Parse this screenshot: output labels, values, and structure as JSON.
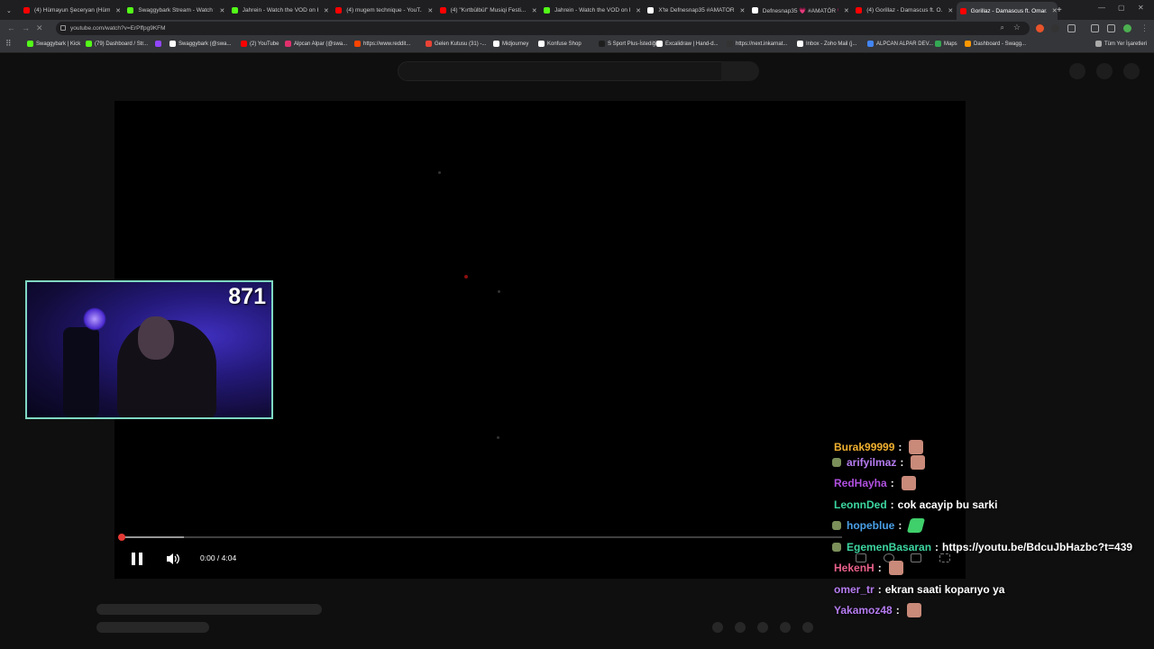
{
  "tabs": [
    {
      "title": "(4) Hümayun Şeceryan (Hümay...",
      "color": "#ff0000",
      "active": false
    },
    {
      "title": "Swaggybark Stream - Watch f...",
      "color": "#53fc18",
      "active": false
    },
    {
      "title": "Jahrein - Watch the VOD on K...",
      "color": "#53fc18",
      "active": false
    },
    {
      "title": "(4) mugem technique - YouT...",
      "color": "#ff0000",
      "active": false
    },
    {
      "title": "(4) \"Kırtbülbül\" Musiqi Festi...",
      "color": "#ff0000",
      "active": false
    },
    {
      "title": "Jahrein - Watch the VOD on K...",
      "color": "#53fc18",
      "active": false
    },
    {
      "title": "X'te Defnesnap35 #AMATÖR...",
      "color": "#ffffff",
      "active": false
    },
    {
      "title": "Defnesnap35 💗 #AMATÖR 💗",
      "color": "#ffffff",
      "active": false
    },
    {
      "title": "(4) Gorillaz - Damascus ft. O...",
      "color": "#ff0000",
      "active": false
    },
    {
      "title": "Gorillaz - Damascus ft. Omar...",
      "color": "#ff0000",
      "active": true
    }
  ],
  "address": {
    "url": "youtube.com/watch?v=ErPffpg9KFM"
  },
  "bookmarks": [
    {
      "label": "Swaggybark | Kick",
      "color": "#53fc18"
    },
    {
      "label": "(79) Dashboard / Str...",
      "color": "#53fc18"
    },
    {
      "label": "",
      "color": "#9146ff"
    },
    {
      "label": "Swaggybark (@swa...",
      "color": "#ffffff"
    },
    {
      "label": "(2) YouTube",
      "color": "#ff0000"
    },
    {
      "label": "Alpcan Alpar (@swa...",
      "color": "#e1306c"
    },
    {
      "label": "https://www.reddit...",
      "color": "#ff4500"
    },
    {
      "label": "Gelen Kutusu (31) -...",
      "color": "#ea4335"
    },
    {
      "label": "Midjourney",
      "color": "#ffffff"
    },
    {
      "label": "Konfuse Shop",
      "color": "#ffffff"
    },
    {
      "label": "S Sport Plus-İstediği...",
      "color": "#1e1e1e"
    },
    {
      "label": "Excalidraw | Hand-d...",
      "color": "#ffffff"
    },
    {
      "label": "https://next.inkarnat...",
      "color": "#333333"
    },
    {
      "label": "Inbox - Zoho Mail (j...",
      "color": "#ffffff"
    },
    {
      "label": "ALPCAN ALPAR DEV...",
      "color": "#4285f4"
    },
    {
      "label": "Maps",
      "color": "#34a853"
    },
    {
      "label": "Dashboard - Swagg...",
      "color": "#ff9800"
    }
  ],
  "bookmarks_all": "Tüm Yer İşaretleri",
  "player": {
    "time": "0:00 / 4:04",
    "progress": 0.0
  },
  "webcam": {
    "count": "871",
    "border_color": "#7fd8c3"
  },
  "chat": [
    {
      "user": "Burak99999",
      "color": "#f0b030",
      "badge": false,
      "message": "",
      "emote": true
    },
    {
      "user": "arifyilmaz",
      "color": "#b57cf0",
      "badge": true,
      "message": "",
      "emote": true
    },
    {
      "user": "RedHayha",
      "color": "#b050e0",
      "badge": false,
      "message": "",
      "emote": true
    },
    {
      "user": "LeonnDed",
      "color": "#3cd6a0",
      "badge": false,
      "message": "cok acayip bu sarki",
      "emote": false
    },
    {
      "user": "hopeblue",
      "color": "#4aa0e8",
      "badge": true,
      "message": "",
      "emote": true,
      "emote_green": true
    },
    {
      "user": "EgemenBasaran",
      "color": "#3cd6a0",
      "badge": true,
      "message": "https://youtu.be/BdcuJbHazbc?t=439",
      "emote": false
    },
    {
      "user": "HekenH",
      "color": "#e8608a",
      "badge": false,
      "message": "",
      "emote": true
    },
    {
      "user": "omer_tr",
      "color": "#b57cf0",
      "badge": false,
      "message": "ekran saati koparıyo ya",
      "emote": false
    },
    {
      "user": "Yakamoz48",
      "color": "#b57cf0",
      "badge": false,
      "message": "",
      "emote": true
    }
  ]
}
